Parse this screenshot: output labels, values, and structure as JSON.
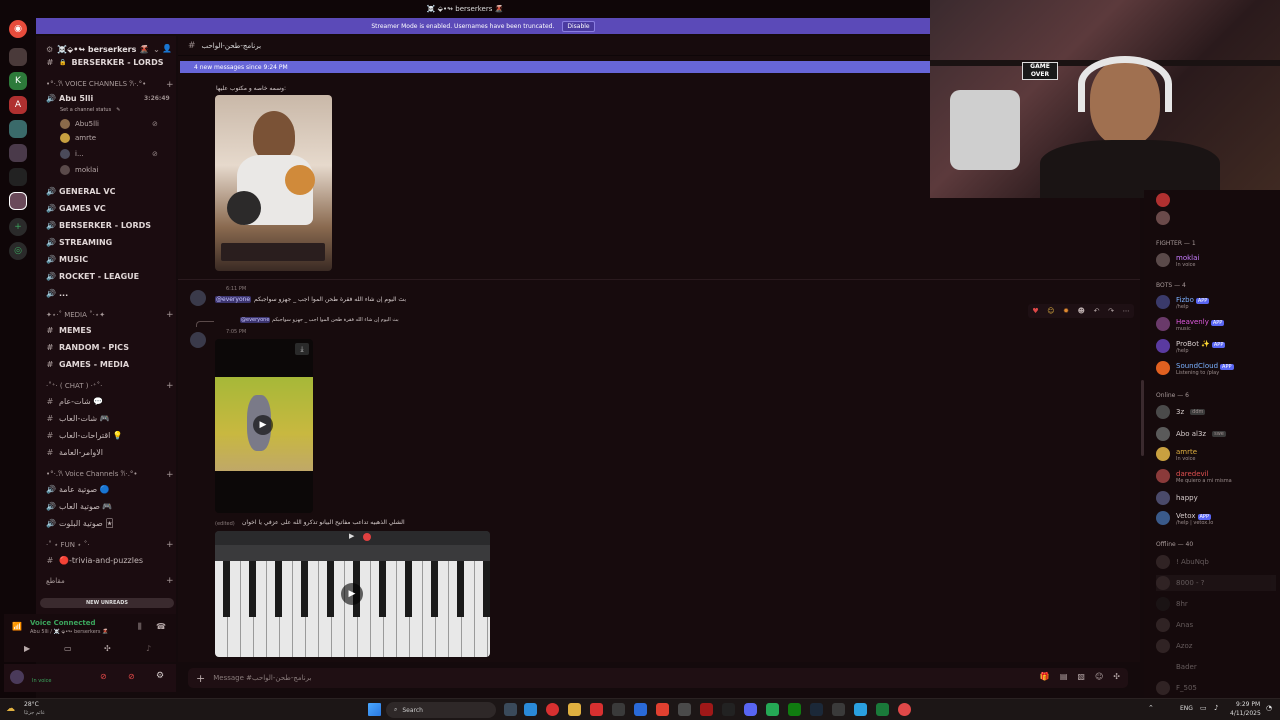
{
  "titlebar": {
    "title": "☠️ ⬙•↬ berserkers 🌋"
  },
  "streamer_banner": {
    "text": "Streamer Mode is enabled. Usernames have been truncated.",
    "button": "Disable"
  },
  "sidebar": {
    "server_name": "☠️⬙•↬ berserkers 🌋",
    "top_channel": "BERSERKER - LORDS",
    "voice_category": "•°·.𐙚 VOICE CHANNELS 𐙚·.°•",
    "active_voice": {
      "name": "Abu 5lli",
      "timer": "3:26:49",
      "status": "Set a channel status",
      "users": [
        "Abu5lli",
        "amrte",
        "i...",
        "moklai"
      ]
    },
    "voice_channels": [
      "GENERAL VC",
      "GAMES VC",
      "BERSERKER - LORDS",
      "STREAMING",
      "MUSIC",
      "ROCKET - LEAGUE",
      "..."
    ],
    "media_category": "✦⋆·˚ MEDIA ˚·⋆✦",
    "media_channels": [
      "MEMES",
      "RANDOM - PICS",
      "GAMES - MEDIA"
    ],
    "chat_category": "·˚⁺‧ ( CHAT ) ‧⁺˚·",
    "chat_channels": [
      "شات-عام 💬",
      "شات-العاب 🎮",
      "اقتراحات-العاب 💡",
      "الاوامر-العامة"
    ],
    "voice_category_2": "•°·.𐙚 Voice Channels 𐙚·.°•",
    "voice_channels_2": [
      "صوتية عامة 🔵",
      "صوتية العاب 🎮",
      "صوتية البلوت 🃏"
    ],
    "fun_category": "·˚ ⋆ FUN ⋆ ˚·",
    "fun_channels": [
      "🔴-trivia-and-puzzles"
    ],
    "misc_category": "مقاطع",
    "new_unreads": "NEW UNREADS",
    "voice_connected": "Voice Connected",
    "voice_location": "Abu 5lli / ☠️ ⬙•↬ berserkers 🌋",
    "user_status": "In voice"
  },
  "chat": {
    "channel_name": "برنامج-طحن-الواحب",
    "new_messages": "4 new messages since 9:24 PM",
    "msg1_text": "وسمه خاصه و مكتوب عليها:",
    "msg2_time": "6:11 PM",
    "msg2_mention": "@everyone",
    "msg2_text": "بث اليوم إن شاء الله فقرة طحن الموا اجب _ جهزو سواجبكم",
    "reply_mention": "@everyone",
    "reply_text": "بث اليوم إن شاء الله فقرة طحن الموا اجب _ جهزو سواجبكم",
    "msg3_time": "7:05 PM",
    "edited_label": "(edited)",
    "msg4_text": "الشلي الذهبيه تداعب مفاتيح البيانو تذكرو الله على عزفي يا اخوان",
    "composer_placeholder": "Message #برنامج-طحن-الواحب"
  },
  "members": {
    "fighter_header": "FIGHTER — 1",
    "fighter": [
      {
        "name": "moklai",
        "status": "In voice"
      }
    ],
    "bots_header": "BOTS — 4",
    "bots": [
      {
        "name": "Fizbo",
        "status": "/help",
        "badge": "APP"
      },
      {
        "name": "Heavenly",
        "status": "music",
        "badge": "APP"
      },
      {
        "name": "ProBot ✨",
        "status": "/help",
        "badge": "APP"
      },
      {
        "name": "SoundCloud",
        "status": "Listening to /play",
        "badge": "APP"
      }
    ],
    "online_header": "Online — 6",
    "online": [
      {
        "name": "3z",
        "status": "",
        "tag": "ddm"
      },
      {
        "name": "Abo al3z",
        "status": "",
        "tag": "swe"
      },
      {
        "name": "amrte",
        "status": "In voice"
      },
      {
        "name": "daredevil",
        "status": "Me quiero a mi misma"
      },
      {
        "name": "happy",
        "status": ""
      },
      {
        "name": "Vetox",
        "status": "/help | vetox.lo",
        "badge": "APP"
      }
    ],
    "offline_header": "Offline — 40",
    "offline": [
      "! AbuNqb",
      "8000 - ?",
      "8hr",
      "Anas",
      "Azoz",
      "Bader",
      "F_505"
    ]
  },
  "webcam": {
    "sign": "GAME OVER"
  },
  "taskbar": {
    "search": "Search",
    "weather_temp": "28°C",
    "weather_desc": "غائم جزئيًا",
    "lang": "ENG",
    "time": "9:29 PM",
    "date": "4/11/2025"
  },
  "colors": {
    "accent": "#5865f2",
    "banner": "#5b4ab8",
    "new_bar": "#6766d8",
    "background": "#170b0d"
  }
}
